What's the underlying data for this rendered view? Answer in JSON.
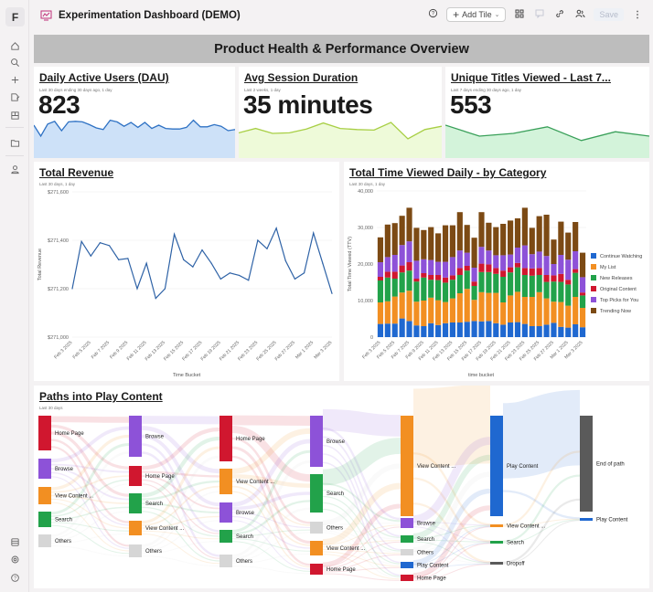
{
  "app": {
    "logo_letter": "F",
    "title": "Experimentation Dashboard (DEMO)"
  },
  "sidebar": {
    "top_icons": [
      "home-icon",
      "search-icon",
      "plus-icon",
      "edit-doc-icon",
      "boards-icon",
      "folder-icon",
      "user-icon"
    ],
    "bottom_icons": [
      "database-icon",
      "settings-icon",
      "help-icon"
    ]
  },
  "toolbar": {
    "help_icon": "help-circle-icon",
    "add_tile_label": "Add Tile",
    "icons": [
      "grid-layout-icon",
      "comment-icon",
      "link-icon",
      "share-users-icon"
    ],
    "save_label": "Save",
    "more_icon": "kebab-menu-icon"
  },
  "banner": {
    "title": "Product Health & Performance Overview"
  },
  "kpis": [
    {
      "title": "Daily Active Users (DAU)",
      "subtitle": "Last 30 days ending 30 days ago, 1 day",
      "value": "823",
      "color": "#2f72c4",
      "fill": "#cde1f8",
      "spark": [
        60,
        40,
        62,
        67,
        50,
        66,
        67,
        66,
        61,
        55,
        52,
        69,
        66,
        58,
        65,
        56,
        65,
        54,
        60,
        54,
        53,
        53,
        56,
        69,
        57,
        57,
        61,
        58,
        50,
        52
      ]
    },
    {
      "title": "Avg Session Duration",
      "subtitle": "Last 2 weeks, 1 day",
      "value": "35 minutes",
      "color": "#a8cf45",
      "fill": "#eefad9",
      "spark": [
        46,
        54,
        45,
        46,
        53,
        64,
        54,
        52,
        51,
        65,
        35,
        52,
        58
      ]
    },
    {
      "title": "Unique Titles Viewed - Last 7...",
      "subtitle": "Last 7 days ending 30 days ago, 1 day",
      "value": "553",
      "color": "#3aa05a",
      "fill": "#d3f3da",
      "spark": [
        60,
        40,
        45,
        57,
        32,
        48,
        40
      ]
    }
  ],
  "revenue": {
    "title": "Total Revenue",
    "subtitle": "Last 30 days, 1 day",
    "chart_data": {
      "type": "line",
      "title": "Total Revenue",
      "xlabel": "Time Bucket",
      "ylabel": "Total Revenue",
      "ylim": [
        271000,
        271600
      ],
      "yticks": [
        "$271,000",
        "$271,200",
        "$271,400",
        "$271,600"
      ],
      "xticks": [
        "Feb 3 2025",
        "Feb 5 2025",
        "Feb 7 2025",
        "Feb 9 2025",
        "Feb 11 2025",
        "Feb 13 2025",
        "Feb 15 2025",
        "Feb 17 2025",
        "Feb 19 2025",
        "Feb 21 2025",
        "Feb 23 2025",
        "Feb 25 2025",
        "Feb 27 2025",
        "Mar 1 2025",
        "Mar 3 2025"
      ],
      "series": [
        {
          "name": "Total Revenue",
          "color": "#2e62a6",
          "values": [
            271200,
            271395,
            271335,
            271390,
            271378,
            271320,
            271325,
            271200,
            271305,
            271160,
            271200,
            271425,
            271320,
            271290,
            271360,
            271305,
            271240,
            271265,
            271255,
            271235,
            271400,
            271365,
            271450,
            271315,
            271240,
            271265,
            271430,
            271305,
            271180
          ]
        }
      ]
    }
  },
  "time_viewed": {
    "title": "Total Time Viewed Daily - by Category",
    "subtitle": "Last 30 days, 1 day",
    "chart_data": {
      "type": "bar",
      "stacked": true,
      "title": "Total Time Viewed Daily - by Category",
      "xlabel": "time bucket",
      "ylabel": "Total Time Viewed (TTV)",
      "ylim": [
        0,
        40000
      ],
      "yticks": [
        "0",
        "10,000",
        "20,000",
        "30,000",
        "40,000"
      ],
      "xticks": [
        "Feb 3 2025",
        "Feb 5 2025",
        "Feb 7 2025",
        "Feb 9 2025",
        "Feb 11 2025",
        "Feb 13 2025",
        "Feb 15 2025",
        "Feb 17 2025",
        "Feb 19 2025",
        "Feb 21 2025",
        "Feb 23 2025",
        "Feb 25 2025",
        "Feb 27 2025",
        "Mar 1 2025",
        "Mar 3 2025"
      ],
      "series": [
        {
          "name": "Continue Watching",
          "color": "#1f68d0",
          "values": [
            3600,
            3700,
            3700,
            5100,
            4400,
            3200,
            3000,
            3800,
            3300,
            3800,
            4000,
            4000,
            4200,
            4400,
            4300,
            4400,
            3800,
            3400,
            4000,
            4100,
            3600,
            3000,
            3000,
            3400,
            3900,
            2800,
            2600,
            3500,
            2700
          ]
        },
        {
          "name": "My List",
          "color": "#f28f22",
          "values": [
            5900,
            6100,
            7400,
            7100,
            8300,
            6500,
            7000,
            7000,
            6800,
            5800,
            6600,
            8000,
            9000,
            5800,
            8000,
            7700,
            8300,
            6100,
            7400,
            8300,
            7400,
            8000,
            9300,
            7200,
            5800,
            6800,
            6000,
            7500,
            5300
          ]
        },
        {
          "name": "New Releases",
          "color": "#22a24a",
          "values": [
            6000,
            6500,
            4900,
            5500,
            5500,
            5500,
            6300,
            4900,
            5500,
            5300,
            5100,
            5000,
            5000,
            3800,
            5500,
            5700,
            5200,
            7000,
            6300,
            6700,
            6000,
            5800,
            4700,
            4500,
            5500,
            5500,
            5800,
            6600,
            3400
          ]
        },
        {
          "name": "Original Content",
          "color": "#d0172f",
          "values": [
            1000,
            1600,
            1900,
            1900,
            2300,
            800,
            1200,
            1300,
            1400,
            1400,
            1200,
            1900,
            1300,
            1200,
            2300,
            2100,
            1600,
            1700,
            1400,
            1200,
            1900,
            2000,
            1900,
            1900,
            1700,
            2200,
            1300,
            1000,
            800
          ]
        },
        {
          "name": "Top Picks for You",
          "color": "#8d52d8",
          "values": [
            4000,
            4000,
            4600,
            5600,
            5700,
            4900,
            3800,
            4100,
            3600,
            4300,
            5000,
            4800,
            3600,
            3800,
            4600,
            3800,
            3500,
            4200,
            3500,
            4200,
            6200,
            3900,
            4500,
            5200,
            3100,
            5200,
            5500,
            4900,
            4200
          ]
        },
        {
          "name": "Trending Now",
          "color": "#7c4a14",
          "values": [
            6800,
            8900,
            8700,
            8000,
            9200,
            9000,
            8000,
            9000,
            7800,
            10000,
            8700,
            10500,
            7600,
            8200,
            9500,
            7600,
            7700,
            8600,
            9300,
            8000,
            10300,
            7200,
            9700,
            11300,
            6700,
            9100,
            7400,
            8000,
            6700
          ]
        }
      ],
      "legend": "right"
    }
  },
  "paths": {
    "title": "Paths into Play Content",
    "subtitle": "Last 30 days",
    "chart_data": {
      "type": "sankey",
      "title": "Paths into Play Content",
      "columns": [
        [
          {
            "label": "Home Page",
            "color": "#d0172f"
          },
          {
            "label": "Browse",
            "color": "#8d52d8"
          },
          {
            "label": "View Content ...",
            "color": "#f28f22"
          },
          {
            "label": "Search",
            "color": "#22a24a"
          },
          {
            "label": "Others",
            "color": "#d6d6d6"
          }
        ],
        [
          {
            "label": "Browse",
            "color": "#8d52d8"
          },
          {
            "label": "Home Page",
            "color": "#d0172f"
          },
          {
            "label": "Search",
            "color": "#22a24a"
          },
          {
            "label": "View Content ...",
            "color": "#f28f22"
          },
          {
            "label": "Others",
            "color": "#d6d6d6"
          }
        ],
        [
          {
            "label": "Home Page",
            "color": "#d0172f"
          },
          {
            "label": "View Content ...",
            "color": "#f28f22"
          },
          {
            "label": "Browse",
            "color": "#8d52d8"
          },
          {
            "label": "Search",
            "color": "#22a24a"
          },
          {
            "label": "Others",
            "color": "#d6d6d6"
          }
        ],
        [
          {
            "label": "Browse",
            "color": "#8d52d8"
          },
          {
            "label": "Search",
            "color": "#22a24a"
          },
          {
            "label": "Others",
            "color": "#d6d6d6"
          },
          {
            "label": "View Content ...",
            "color": "#f28f22"
          },
          {
            "label": "Home Page",
            "color": "#d0172f"
          }
        ],
        [
          {
            "label": "View Content ...",
            "color": "#f28f22"
          },
          {
            "label": "Browse",
            "color": "#8d52d8"
          },
          {
            "label": "Search",
            "color": "#22a24a"
          },
          {
            "label": "Others",
            "color": "#d6d6d6"
          },
          {
            "label": "Play Content",
            "color": "#1f68d0"
          },
          {
            "label": "Home Page",
            "color": "#d0172f"
          }
        ],
        [
          {
            "label": "Play Content",
            "color": "#1f68d0"
          },
          {
            "label": "View Content ...",
            "color": "#f28f22"
          },
          {
            "label": "Search",
            "color": "#22a24a"
          },
          {
            "label": "Dropoff",
            "color": "#5a5a5a"
          }
        ],
        [
          {
            "label": "End of path",
            "color": "#5a5a5a"
          },
          {
            "label": "Play Content",
            "color": "#1f68d0"
          }
        ]
      ]
    }
  }
}
